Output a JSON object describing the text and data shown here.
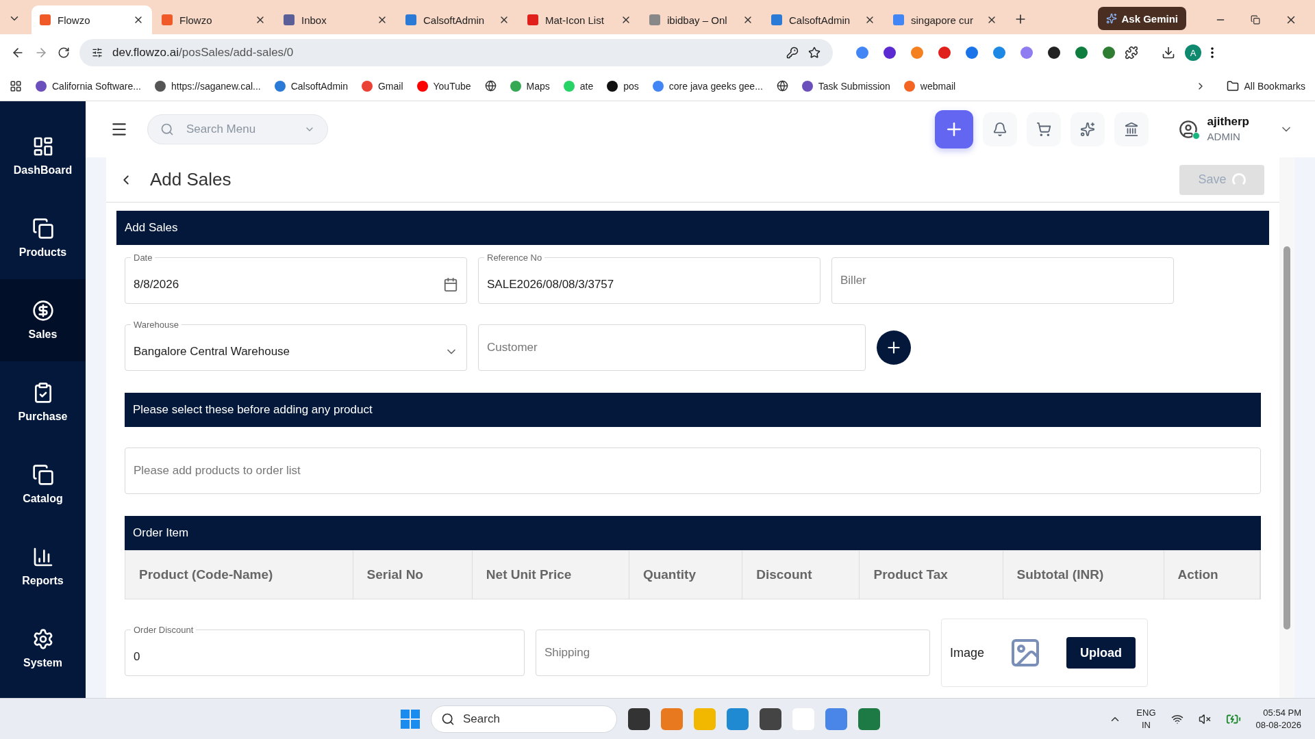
{
  "browser": {
    "tabs": [
      {
        "title": "Flowzo",
        "selected": true,
        "color": "#f05a28"
      },
      {
        "title": "Flowzo",
        "selected": false,
        "color": "#f05a28"
      },
      {
        "title": "Inbox",
        "selected": false,
        "color": "#5b5f97"
      },
      {
        "title": "CalsoftAdmin",
        "selected": false,
        "color": "#2b7bd6"
      },
      {
        "title": "Mat-Icon List",
        "selected": false,
        "color": "#e0201b"
      },
      {
        "title": "ibidbay – Onl",
        "selected": false,
        "color": "#888888"
      },
      {
        "title": "CalsoftAdmin",
        "selected": false,
        "color": "#2b7bd6"
      },
      {
        "title": "singapore cur",
        "selected": false,
        "color": "#4285f4"
      }
    ],
    "gemini_button": "Ask Gemini",
    "url_host": "dev.flowzo.ai",
    "url_path": "/posSales/add-sales/0",
    "profile_initial": "A",
    "bookmarks": [
      {
        "label": "California Software...",
        "color": "#6b4fbb"
      },
      {
        "label": "https://saganew.cal...",
        "color": "#555555"
      },
      {
        "label": "CalsoftAdmin",
        "color": "#2b7bd6"
      },
      {
        "label": "Gmail",
        "color": "#ea4335"
      },
      {
        "label": "YouTube",
        "color": "#ff0000"
      },
      {
        "kind": "globe",
        "color": "#333333"
      },
      {
        "label": "Maps",
        "color": "#34a853"
      },
      {
        "label": "ate",
        "color": "#25d366"
      },
      {
        "label": "pos",
        "color": "#111111"
      },
      {
        "label": "core java geeks gee...",
        "color": "#4285f4"
      },
      {
        "kind": "globe",
        "color": "#333333"
      },
      {
        "label": "Task Submission",
        "color": "#6b4fbb"
      },
      {
        "label": "webmail",
        "color": "#f26522"
      }
    ],
    "all_bookmarks": "All Bookmarks"
  },
  "sidebar": {
    "items": [
      {
        "label": "DashBoard",
        "kind": "dashboard",
        "selected": false
      },
      {
        "label": "Products",
        "kind": "products",
        "selected": false
      },
      {
        "label": "Sales",
        "kind": "sales",
        "selected": true
      },
      {
        "label": "Purchase",
        "kind": "purchase",
        "selected": false
      },
      {
        "label": "Catalog",
        "kind": "catalog",
        "selected": false
      },
      {
        "label": "Reports",
        "kind": "reports",
        "selected": false
      },
      {
        "label": "System",
        "kind": "system",
        "selected": false
      }
    ]
  },
  "topbar": {
    "search_placeholder": "Search Menu",
    "user": {
      "name": "ajitherp",
      "role": "ADMIN",
      "online": true
    }
  },
  "page": {
    "title": "Add Sales",
    "save": {
      "label": "Save",
      "disabled": true,
      "loading": true
    }
  },
  "form": {
    "title": "Add Sales",
    "row_1": [
      {
        "kind": "date",
        "label": "Date",
        "value": "8/8/2026"
      },
      {
        "kind": "text",
        "label": "Reference No",
        "value": "SALE2026/08/08/3/3757"
      },
      {
        "kind": "text",
        "placeholder": "Biller"
      }
    ],
    "row_2": [
      {
        "kind": "select",
        "label": "Warehouse",
        "value": "Bangalore Central Warehouse"
      },
      {
        "kind": "text",
        "placeholder": "Customer"
      }
    ],
    "notice": "Please select these before adding any product",
    "product_placeholder": "Please add products to order list",
    "order_title": "Order Item",
    "table": {
      "columns": [
        "Product (Code-Name)",
        "Serial No",
        "Net Unit Price",
        "Quantity",
        "Discount",
        "Product Tax",
        "Subtotal (INR)",
        "Action"
      ]
    },
    "row_3": [
      {
        "kind": "text",
        "label": "Order Discount",
        "value": "0"
      },
      {
        "kind": "text",
        "placeholder": "Shipping"
      }
    ],
    "image": {
      "label": "Image",
      "button": "Upload"
    }
  },
  "taskbar": {
    "search_placeholder": "Search",
    "language": "ENG",
    "region": "IN",
    "time": "05:54 PM",
    "date": "08-08-2026"
  }
}
